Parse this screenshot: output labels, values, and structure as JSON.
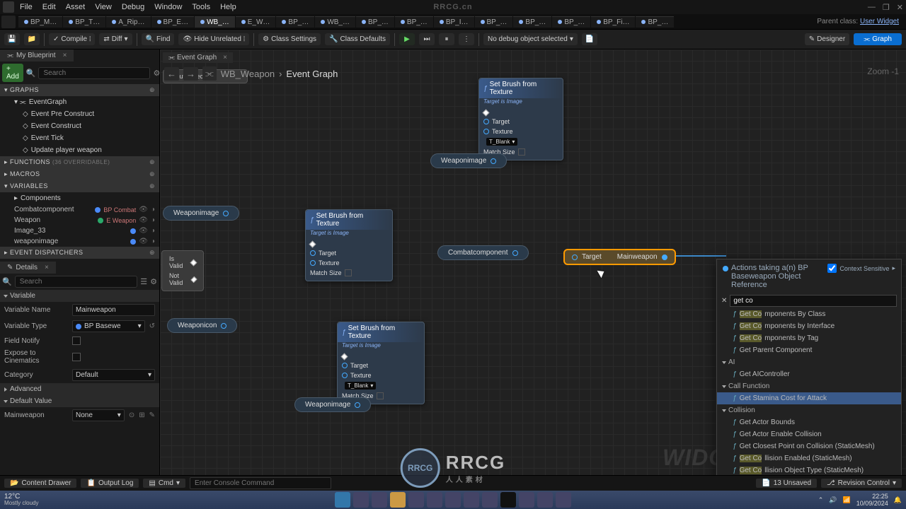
{
  "menu": [
    "File",
    "Edit",
    "Asset",
    "View",
    "Debug",
    "Window",
    "Tools",
    "Help"
  ],
  "brand": "RRCG.cn",
  "parentclass_label": "Parent class:",
  "parentclass_value": "User Widget",
  "file_tabs": [
    "BP_M…",
    "BP_T…",
    "A_Rip…",
    "BP_E…",
    "WB_…",
    "E_W…",
    "BP_…",
    "WB_…",
    "BP_…",
    "BP_…",
    "BP_I…",
    "BP_…",
    "BP_…",
    "BP_…",
    "BP_Fi…",
    "BP_…"
  ],
  "active_tab_index": 4,
  "toolbar": {
    "compile": "Compile",
    "diff": "Diff",
    "find": "Find",
    "hide_unrelated": "Hide Unrelated",
    "class_settings": "Class Settings",
    "class_defaults": "Class Defaults",
    "no_debug": "No debug object selected",
    "designer": "Designer",
    "graph": "Graph"
  },
  "left": {
    "tab": "My Blueprint",
    "add": "+ Add",
    "search_ph": "Search",
    "graphs_section": "GRAPHS",
    "eventgraph": "EventGraph",
    "events": [
      "Event Pre Construct",
      "Event Construct",
      "Event Tick",
      "Update player weapon"
    ],
    "functions_section": "FUNCTIONS",
    "functions_extra": "(36 OVERRIDABLE)",
    "macros_section": "MACROS",
    "variables_section": "VARIABLES",
    "components_cat": "Components",
    "vars": [
      {
        "name": "Combatcomponent",
        "type": "BP Combat",
        "color": "#4a8af8"
      },
      {
        "name": "Weapon",
        "type": "E Weapon",
        "color": "#2aa96a"
      },
      {
        "name": "Image_33",
        "type": "",
        "color": "#4a8af8"
      },
      {
        "name": "weaponimage",
        "type": "",
        "color": "#4a8af8"
      }
    ],
    "event_dispatchers": "EVENT DISPATCHERS"
  },
  "details": {
    "tab": "Details",
    "search_ph": "Search",
    "variable_group": "Variable",
    "name_lbl": "Variable Name",
    "name_val": "Mainweapon",
    "type_lbl": "Variable Type",
    "type_val": "BP Basewe",
    "notify_lbl": "Field Notify",
    "cine_lbl": "Expose to Cinematics",
    "cat_lbl": "Category",
    "cat_val": "Default",
    "advanced": "Advanced",
    "default_value_group": "Default Value",
    "mainweapon_lbl": "Mainweapon",
    "mainweapon_val": "None"
  },
  "graph": {
    "tab": "Event Graph",
    "crumb_class": "WB_Weapon",
    "crumb_graph": "Event Graph",
    "zoom": "Zoom -1"
  },
  "nodes": {
    "set_brush": "Set Brush from Texture",
    "target_is": "Target is Image",
    "target": "Target",
    "texture": "Texture",
    "blank": "T_Blank",
    "match_size": "Match Size",
    "weaponimage": "Weaponimage",
    "weaponicon": "Weaponicon",
    "combatcomponent": "Combatcomponent",
    "mainweapon_target": "Target",
    "mainweapon": "Mainweapon",
    "is_valid": "Is Valid",
    "not_valid": "Not Valid",
    "input_object": "Input Object"
  },
  "context": {
    "title": "Actions taking a(n) BP Baseweapon Object Reference",
    "context_sensitive": "Context Sensitive",
    "search": "get co",
    "items": [
      {
        "type": "item",
        "text": "Get Components By Class",
        "hl": "Get Co"
      },
      {
        "type": "item",
        "text": "Get Components by Interface",
        "hl": "Get Co"
      },
      {
        "type": "item",
        "text": "Get Components by Tag",
        "hl": "Get Co"
      },
      {
        "type": "item",
        "text": "Get Parent Component"
      },
      {
        "type": "cat",
        "text": "AI"
      },
      {
        "type": "item",
        "text": "Get AIController"
      },
      {
        "type": "cat",
        "text": "Call Function"
      },
      {
        "type": "item",
        "text": "Get Stamina Cost for Attack",
        "sel": true
      },
      {
        "type": "cat",
        "text": "Collision"
      },
      {
        "type": "item",
        "text": "Get Actor Bounds"
      },
      {
        "type": "item",
        "text": "Get Actor Enable Collision"
      },
      {
        "type": "item",
        "text": "Get Closest Point on Collision (StaticMesh)"
      },
      {
        "type": "item",
        "text": "Get Collision Enabled (StaticMesh)",
        "hl": "Get Co"
      },
      {
        "type": "item",
        "text": "Get Collision Object Type (StaticMesh)",
        "hl": "Get Co"
      }
    ]
  },
  "bottom": {
    "content_drawer": "Content Drawer",
    "output_log": "Output Log",
    "cmd": "Cmd",
    "cmd_ph": "Enter Console Command",
    "unsaved": "13 Unsaved",
    "revision": "Revision Control"
  },
  "taskbar": {
    "temp": "12°C",
    "cond": "Mostly cloudy",
    "time": "22:25",
    "date": "10/09/2024"
  },
  "logo": {
    "ring": "RRCG",
    "txt": "RRCG",
    "sub": "人人素材"
  },
  "watermark": "WIDGET BLUEPRINT"
}
